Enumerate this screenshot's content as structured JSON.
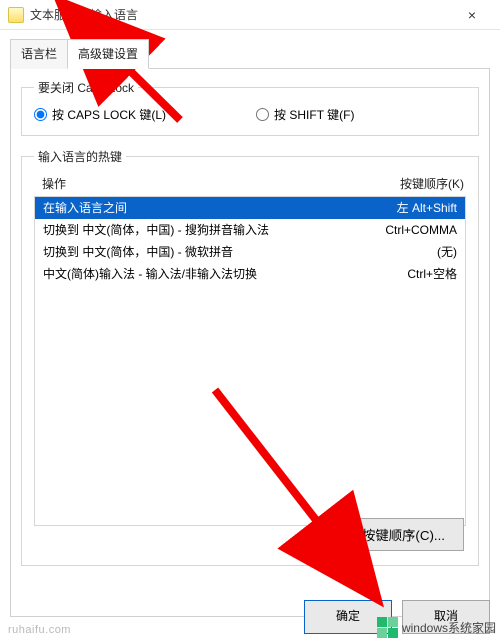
{
  "window": {
    "title": "文本服务和输入语言",
    "close": "×"
  },
  "tabs": {
    "inactive": "语言栏",
    "active": "高级键设置"
  },
  "capslock_group": {
    "legend": "要关闭 Caps Lock",
    "opt1": "按 CAPS LOCK 键(L)",
    "opt2": "按 SHIFT 键(F)"
  },
  "hotkeys_group": {
    "legend": "输入语言的热键",
    "col_action": "操作",
    "col_key": "按键顺序(K)",
    "rows": [
      {
        "action": "在输入语言之间",
        "key": "左 Alt+Shift",
        "selected": true
      },
      {
        "action": "切换到 中文(简体，中国) - 搜狗拼音输入法",
        "key": "Ctrl+COMMA"
      },
      {
        "action": "切换到 中文(简体，中国) - 微软拼音",
        "key": "(无)"
      },
      {
        "action": "中文(简体)输入法 - 输入法/非输入法切换",
        "key": "Ctrl+空格"
      }
    ],
    "change_button": "更改按键顺序(C)..."
  },
  "footer": {
    "ok": "确定",
    "cancel": "取消"
  },
  "watermark": "ruhaifu.com",
  "brand": {
    "text1": "windows系统家园"
  }
}
